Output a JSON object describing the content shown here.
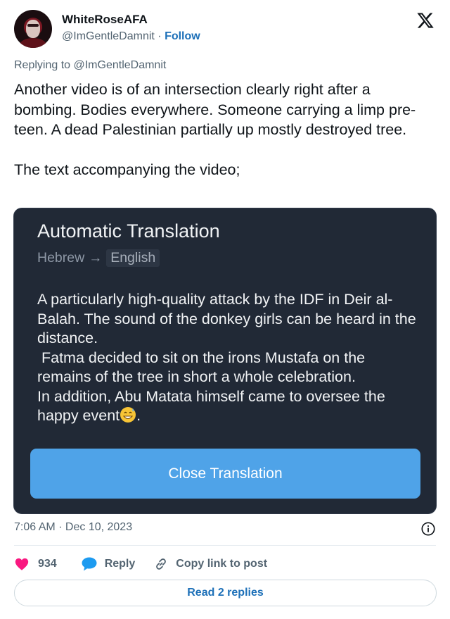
{
  "author": {
    "display_name": "WhiteRoseAFA",
    "handle": "@ImGentleDamnit",
    "separator": " · ",
    "follow_label": "Follow"
  },
  "replying_to": "Replying to @ImGentleDamnit",
  "tweet": {
    "paragraphs": [
      "Another video is of an intersection clearly right after a bombing. Bodies everywhere. Someone carrying a limp pre-teen. A dead Palestinian partially up mostly destroyed tree.",
      "The text accompanying the video;"
    ]
  },
  "media": {
    "title": "Automatic Translation",
    "source_lang": "Hebrew",
    "arrow": "→",
    "target_lang": "English",
    "translation": "A particularly high-quality attack by the IDF in Deir al-Balah. The sound of the donkey girls can be heard in the distance.\n Fatma decided to sit on the irons Mustafa on the remains of the tree in short a whole celebration.\nIn addition, Abu Matata himself came to oversee the happy event",
    "translation_end": ".",
    "close_label": "Close Translation"
  },
  "meta": {
    "timestamp": "7:06 AM · Dec 10, 2023"
  },
  "actions": {
    "like_count": "934",
    "reply_label": "Reply",
    "copy_label": "Copy link to post"
  },
  "read_replies_label": "Read 2 replies",
  "colors": {
    "like": "#f91880",
    "link": "#1d70b8",
    "reply_icon": "#1d9bf0",
    "media_bg": "#212936",
    "button_bg": "#4fa3e8"
  },
  "icons": {
    "brand": "x-logo-icon",
    "like": "heart-icon",
    "reply": "speech-bubble-icon",
    "copy": "link-icon",
    "info": "info-icon",
    "emoji": "grinning-sweat-emoji-icon"
  }
}
